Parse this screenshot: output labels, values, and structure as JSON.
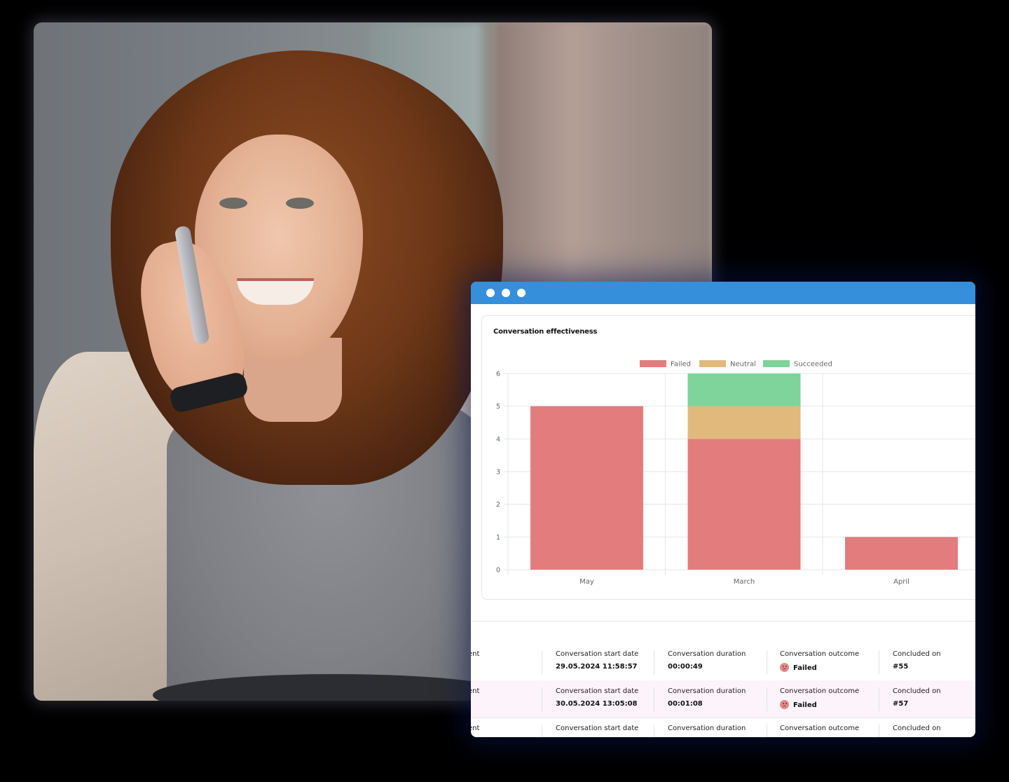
{
  "window": {
    "titlebar_color": "#358FDA",
    "titlebar_dots": [
      "dot",
      "dot",
      "dot"
    ]
  },
  "panel": {
    "title": "Conversation effectiveness"
  },
  "chart_data": {
    "type": "bar",
    "stacked": true,
    "title": "Conversation effectiveness",
    "categories": [
      "May",
      "March",
      "April"
    ],
    "series": [
      {
        "name": "Failed",
        "color": "#E37C7C",
        "values": [
          5,
          4,
          1
        ]
      },
      {
        "name": "Neutral",
        "color": "#E2B97C",
        "values": [
          0,
          1,
          0
        ]
      },
      {
        "name": "Succeeded",
        "color": "#7ED49A",
        "values": [
          0,
          1,
          0
        ]
      }
    ],
    "yticks": [
      0,
      1,
      2,
      3,
      4,
      5,
      6
    ],
    "ylim": [
      0,
      6
    ],
    "xlabel": "",
    "ylabel": "",
    "grid": true,
    "legend": "top-center"
  },
  "table": {
    "rows": [
      {
        "highlight": false,
        "cells": [
          {
            "label": "ent",
            "value": ""
          },
          {
            "label": "Conversation start date",
            "value": "29.05.2024 11:58:57"
          },
          {
            "label": "Conversation duration",
            "value": "00:00:49"
          },
          {
            "label": "Conversation outcome",
            "value": "Failed",
            "icon": "sad-face-icon"
          },
          {
            "label": "Concluded on",
            "value": "#55"
          }
        ]
      },
      {
        "highlight": true,
        "cells": [
          {
            "label": "ent",
            "value": ""
          },
          {
            "label": "Conversation start date",
            "value": "30.05.2024 13:05:08"
          },
          {
            "label": "Conversation duration",
            "value": "00:01:08"
          },
          {
            "label": "Conversation outcome",
            "value": "Failed",
            "icon": "sad-face-icon"
          },
          {
            "label": "Concluded on",
            "value": "#57"
          }
        ]
      },
      {
        "highlight": false,
        "cells": [
          {
            "label": "ent",
            "value": ""
          },
          {
            "label": "Conversation start date",
            "value": ""
          },
          {
            "label": "Conversation duration",
            "value": ""
          },
          {
            "label": "Conversation outcome",
            "value": ""
          },
          {
            "label": "Concluded on",
            "value": ""
          }
        ]
      }
    ]
  }
}
